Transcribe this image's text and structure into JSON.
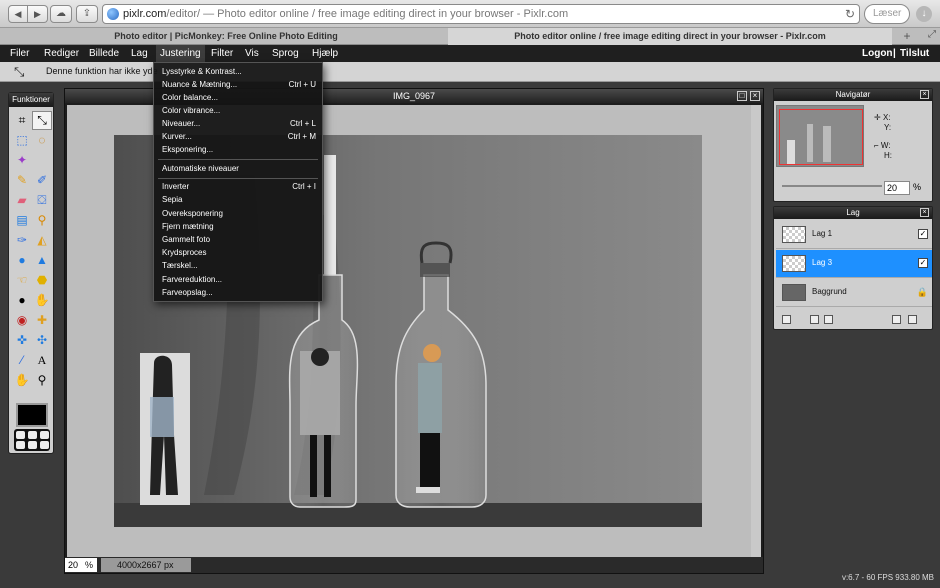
{
  "browser": {
    "url_host": "pixlr.com",
    "url_rest": "/editor/",
    "page_title": " — Photo editor online / free image editing direct in your browser - Pixlr.com",
    "reload_icon": "reload-icon",
    "search_placeholder": "Læser"
  },
  "tabs": [
    {
      "label": "Photo editor | PicMonkey: Free Online Photo Editing"
    },
    {
      "label": "Photo editor online / free image editing direct in your browser - Pixlr.com"
    }
  ],
  "menubar": {
    "items": [
      "Filer",
      "Rediger",
      "Billede",
      "Lag",
      "Justering",
      "Filter",
      "Vis",
      "Sprog",
      "Hjælp"
    ],
    "logon": "Logon",
    "divider": "|",
    "tilslut": "Tilslut"
  },
  "options": {
    "message": "Denne funktion har ikke yde"
  },
  "tools_panel": {
    "title": "Funktioner"
  },
  "document": {
    "title": "IMG_0967",
    "zoom": "20",
    "zoom_unit": "%",
    "dimensions": "4000x2667 px"
  },
  "dropdown": {
    "items": [
      {
        "label": "Lysstyrke & Kontrast...",
        "shortcut": ""
      },
      {
        "label": "Nuance & Mætning...",
        "shortcut": "Ctrl + U"
      },
      {
        "label": "Color balance...",
        "shortcut": ""
      },
      {
        "label": "Color vibrance...",
        "shortcut": ""
      },
      {
        "label": "Niveauer...",
        "shortcut": "Ctrl + L"
      },
      {
        "label": "Kurver...",
        "shortcut": "Ctrl + M"
      },
      {
        "label": "Eksponering...",
        "shortcut": ""
      },
      {
        "label": "Automatiske niveauer",
        "shortcut": ""
      },
      {
        "label": "Inverter",
        "shortcut": "Ctrl + I"
      },
      {
        "label": "Sepia",
        "shortcut": ""
      },
      {
        "label": "Overeksponering",
        "shortcut": ""
      },
      {
        "label": "Fjern mætning",
        "shortcut": ""
      },
      {
        "label": "Gammelt foto",
        "shortcut": ""
      },
      {
        "label": "Krydsproces",
        "shortcut": ""
      },
      {
        "label": "Tærskel...",
        "shortcut": ""
      },
      {
        "label": "Farvereduktion...",
        "shortcut": ""
      },
      {
        "label": "Farveopslag...",
        "shortcut": ""
      }
    ]
  },
  "navigator": {
    "title": "Navigatør",
    "x_label": "X:",
    "y_label": "Y:",
    "w_label": "W:",
    "h_label": "H:",
    "zoom": "20",
    "zoom_unit": "%"
  },
  "layers": {
    "title": "Lag",
    "items": [
      {
        "name": "Lag 1"
      },
      {
        "name": "Lag 3"
      },
      {
        "name": "Baggrund"
      }
    ]
  },
  "status": {
    "fps": "v:6.7 - 60 FPS 933.80 MB"
  }
}
